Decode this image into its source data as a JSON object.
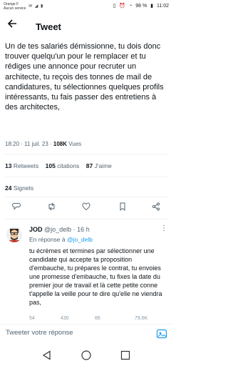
{
  "status_bar": {
    "carrier_line1": "Orange F",
    "carrier_line2": "Aucun service",
    "left_icons": "✉ ◢ ▮",
    "battery_percent": "98 %",
    "time": "11:02"
  },
  "header": {
    "title": "Tweet"
  },
  "tweet": {
    "text": "Un de tes salariés démissionne, tu dois donc trouver quelqu'un pour le remplacer et tu rédiges une annonce pour recruter un architecte, tu reçois des tonnes de mail de candidatures, tu sélectionnes quelques profils intéressants, tu fais passer des entretiens à des architectes,",
    "time": "18:20 · 11 juil. 23 · ",
    "views_count": "108K",
    "views_label": " Vues",
    "retweets_count": "13",
    "retweets_label": " Retweets",
    "quotes_count": "105",
    "quotes_label": " citations",
    "likes_count": "87",
    "likes_label": " J'aime",
    "bookmarks_count": "24",
    "bookmarks_label": " Signets"
  },
  "reply": {
    "name": "JOD",
    "handle": " @jo_delb · 16 h",
    "reply_prefix": "En réponse à ",
    "reply_to": "@jo_delb",
    "text": "tu écrèmes et termines par sélectionner une candidate qui accepte ta proposition d'embauche, tu prépares le contrat, tu envoies une promesse d'embauche, tu fixes la date du premier jour de travail et là cette petite conne t'appelle la veille pour te dire qu'elle ne viendra pas,",
    "stats": [
      "54",
      "430",
      "66",
      "79,6K"
    ]
  },
  "compose": {
    "placeholder": "Tweeter votre réponse"
  },
  "colors": {
    "accent": "#1d9bf0",
    "text": "#0f1419",
    "secondary": "#536471"
  }
}
